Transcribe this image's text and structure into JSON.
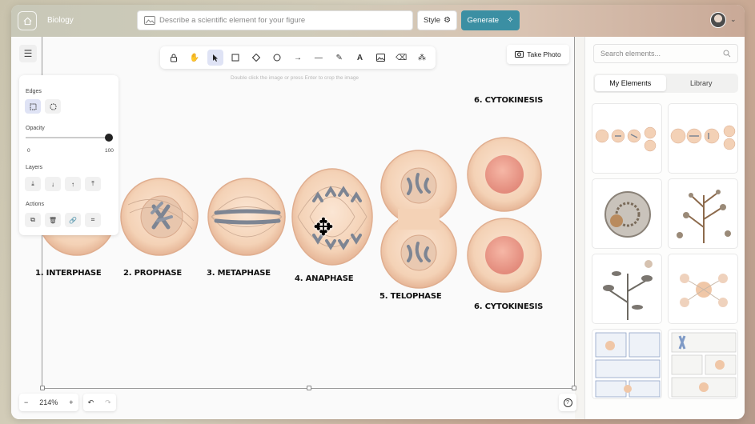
{
  "header": {
    "project_title": "Biology",
    "prompt_placeholder": "Describe a scientific element for your figure",
    "style_label": "Style",
    "generate_label": "Generate"
  },
  "toolbar": {
    "tools": [
      "lock-icon",
      "hand-icon",
      "pointer-icon",
      "rectangle-icon",
      "diamond-icon",
      "circle-icon",
      "arrow-icon",
      "line-icon",
      "pencil-icon",
      "text-icon",
      "image-icon",
      "eraser-icon",
      "more-shapes-icon"
    ],
    "active_tool": "pointer-icon",
    "hint": "Double click the image or press Enter to crop the image",
    "take_photo_label": "Take Photo"
  },
  "properties_panel": {
    "edges_label": "Edges",
    "opacity_label": "Opacity",
    "opacity_min": "0",
    "opacity_max": "100",
    "opacity_value": 100,
    "layers_label": "Layers",
    "actions_label": "Actions"
  },
  "figure": {
    "top_label": "6. CYTOKINESIS",
    "stages": [
      "1. INTERPHASE",
      "2. PROPHASE",
      "3. METAPHASE",
      "4. ANAPHASE",
      "5. TELOPHASE",
      "6. CYTOKINESIS"
    ],
    "colors": {
      "cell": "#f3d1b6",
      "cell_edge": "#e2b394",
      "nucleus": "#e89a8a",
      "chromosome": "#7d8593"
    }
  },
  "bottom": {
    "zoom_out": "−",
    "zoom_level": "214%",
    "zoom_in": "+",
    "undo": "↶",
    "redo": "↷",
    "help": "?"
  },
  "sidebar": {
    "search_placeholder": "Search elements...",
    "tabs": [
      "My Elements",
      "Library"
    ],
    "active_tab": "My Elements"
  },
  "colors": {
    "accent": "#3b8fa3",
    "active_tool_bg": "#dfe3f5"
  }
}
